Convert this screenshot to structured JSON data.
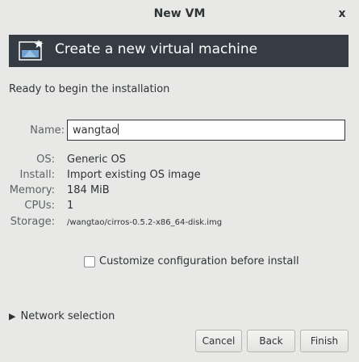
{
  "window": {
    "title": "New VM",
    "close": "x"
  },
  "banner": {
    "title": "Create a new virtual machine",
    "icon": "new-vm-icon"
  },
  "summary": {
    "ready_text": "Ready to begin the installation"
  },
  "fields": {
    "name_label": "Name:",
    "name_value": "wangtao",
    "os_label": "OS:",
    "os_value": "Generic OS",
    "install_label": "Install:",
    "install_value": "Import existing OS image",
    "memory_label": "Memory:",
    "memory_value": "184 MiB",
    "cpus_label": "CPUs:",
    "cpus_value": "1",
    "storage_label": "Storage:",
    "storage_value": "/wangtao/cirros-0.5.2-x86_64-disk.img"
  },
  "customize": {
    "label": "Customize configuration before install",
    "checked": false
  },
  "network": {
    "label": "Network selection",
    "expanded": false
  },
  "buttons": {
    "cancel": "Cancel",
    "back": "Back",
    "finish": "Finish"
  },
  "colors": {
    "banner_bg": "#353c43",
    "window_bg": "#e8e8e7",
    "label_text": "#5c6366",
    "text": "#2e3436"
  }
}
